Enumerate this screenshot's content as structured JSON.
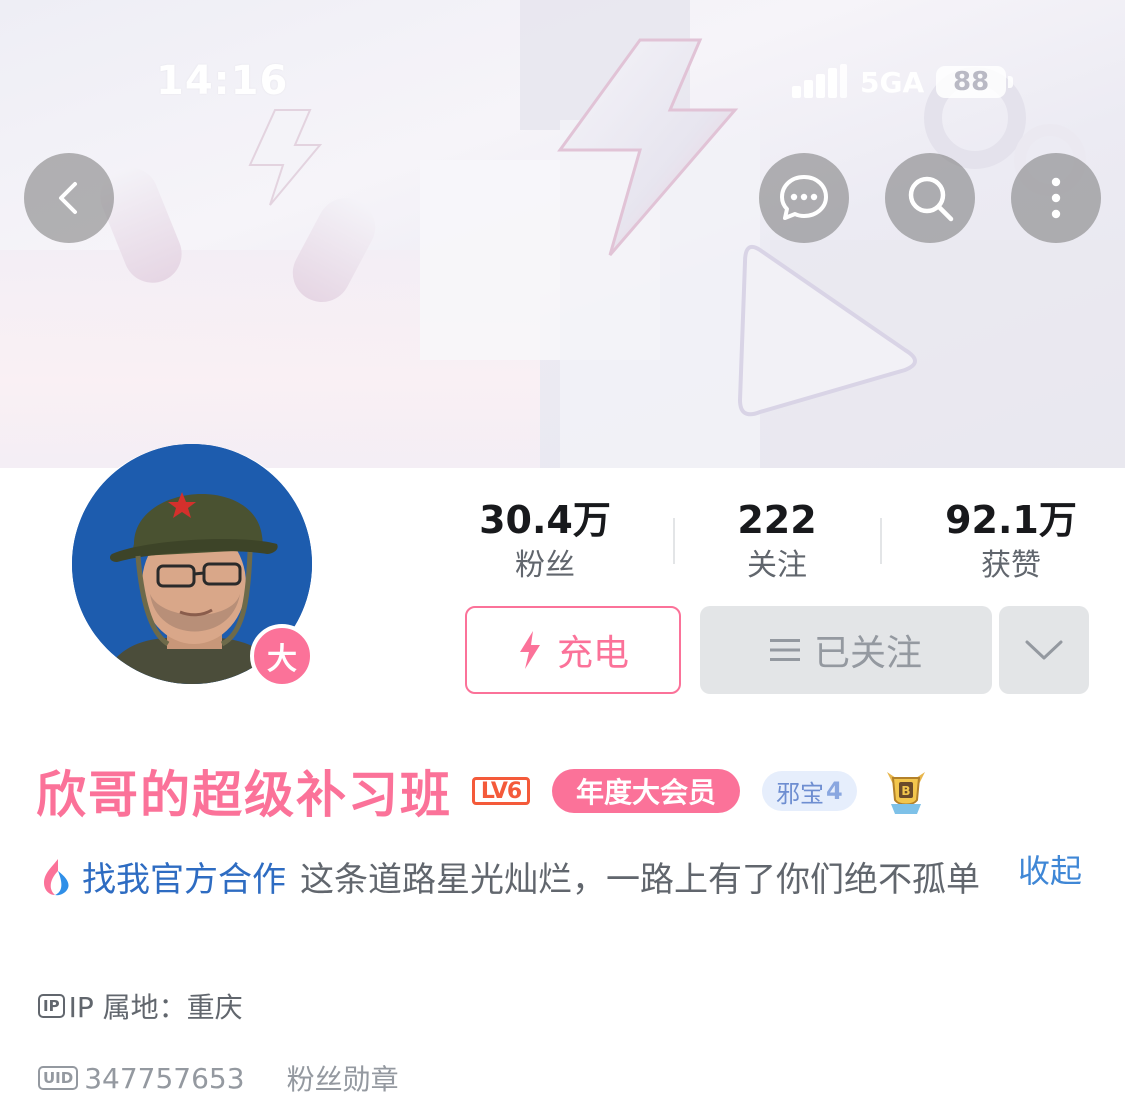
{
  "status_bar": {
    "time": "14:16",
    "network": "5GA",
    "battery": "88"
  },
  "header": {
    "back_icon": "chevron-left-icon",
    "actions": [
      "chat-bubble-icon",
      "search-icon",
      "more-vertical-icon"
    ]
  },
  "profile": {
    "avatar_badge": "大",
    "username": "欣哥的超级补习班",
    "level": "LV6",
    "vip_label": "年度大会员",
    "medal_name": "邪宝",
    "medal_level": "4",
    "stats": [
      {
        "value": "30.4万",
        "label": "粉丝"
      },
      {
        "value": "222",
        "label": "关注"
      },
      {
        "value": "92.1万",
        "label": "获赞"
      }
    ],
    "charge_label": "充电",
    "followed_label": "已关注",
    "coop_label": "找我官方合作",
    "bio": "这条道路星光灿烂，一路上有了你们绝不孤单",
    "collapse_label": "收起",
    "ip_icon_text": "IP",
    "ip_location": "IP 属地：重庆",
    "uid_icon_text": "UID",
    "uid": "347757653",
    "fans_medal_label": "粉丝勋章"
  },
  "colors": {
    "accent_pink": "#fb7299",
    "link_blue": "#3f87d6",
    "level_red": "#f45a3a"
  }
}
